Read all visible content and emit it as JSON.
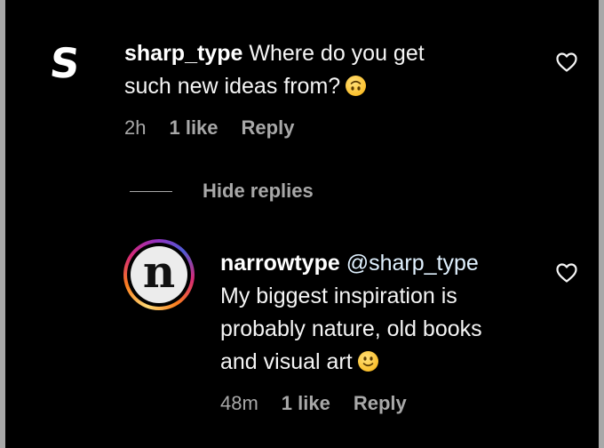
{
  "comment": {
    "avatar_letter": "S",
    "username": "sharp_type",
    "text_line1": "Where do you get",
    "text_line2": "such new ideas from?",
    "emoji": "upside-down-face-emoji",
    "time": "2h",
    "likes": "1 like",
    "reply_label": "Reply"
  },
  "thread": {
    "hide_replies_label": "Hide replies"
  },
  "reply": {
    "avatar_letter": "n",
    "username": "narrowtype",
    "mention": "@sharp_type",
    "text_line1": "My biggest inspiration is",
    "text_line2": "probably nature, old books",
    "text_line3": "and visual art",
    "emoji": "smiling-face-emoji",
    "time": "48m",
    "likes": "1 like",
    "reply_label": "Reply"
  },
  "colors": {
    "background": "#000000",
    "text_primary": "#f5f5f5",
    "text_secondary": "#a8a8a8",
    "emoji_yellow": "#fbc02d"
  }
}
